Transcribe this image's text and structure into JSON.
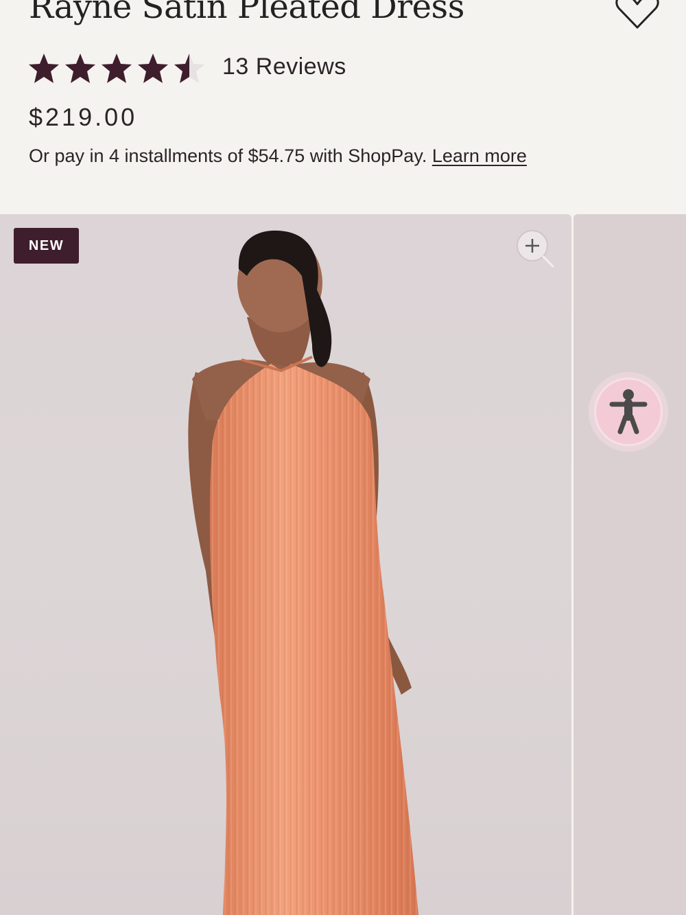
{
  "product": {
    "title": "Rayne Satin Pleated Dress",
    "rating": 4.5,
    "rating_max": 5,
    "reviews_label": "13 Reviews",
    "price": "$219.00",
    "installments_text": "Or pay in 4 installments of $54.75 with ShopPay.",
    "learn_more": "Learn more"
  },
  "gallery": {
    "badge": "NEW"
  },
  "icons": {
    "wishlist": "heart-icon",
    "zoom": "zoom-in-icon",
    "accessibility": "accessibility-icon"
  },
  "colors": {
    "accent": "#3e1e2d",
    "background": "#f5f3f0",
    "dress": "#e98e6a",
    "accessibility_bg": "#f2cbd6"
  }
}
